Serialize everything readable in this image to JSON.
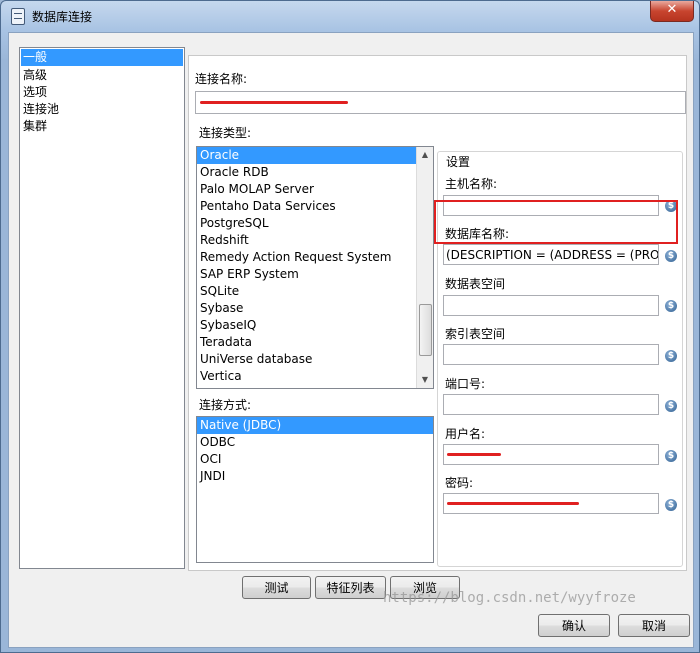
{
  "window": {
    "title": "数据库连接",
    "close_glyph": "✕"
  },
  "nav": {
    "items": [
      "一般",
      "高级",
      "选项",
      "连接池",
      "集群"
    ],
    "selected_index": 0
  },
  "general": {
    "conn_name_label": "连接名称:",
    "conn_type_label": "连接类型:",
    "conn_types": [
      "Oracle",
      "Oracle RDB",
      "Palo MOLAP Server",
      "Pentaho Data Services",
      "PostgreSQL",
      "Redshift",
      "Remedy Action Request System",
      "SAP ERP System",
      "SQLite",
      "Sybase",
      "SybaseIQ",
      "Teradata",
      "UniVerse database",
      "Vertica"
    ],
    "conn_types_selected": "Oracle",
    "access_label": "连接方式:",
    "access_methods": [
      "Native (JDBC)",
      "ODBC",
      "OCI",
      "JNDI"
    ],
    "access_selected": "Native (JDBC)"
  },
  "settings": {
    "group_label": "设置",
    "host_label": "主机名称:",
    "host_value": "",
    "db_name_label": "数据库名称:",
    "db_name_value": "(DESCRIPTION = (ADDRESS = (PROTOCOL",
    "tablespace_data_label": "数据表空间",
    "tablespace_data_value": "",
    "tablespace_index_label": "索引表空间",
    "tablespace_index_value": "",
    "port_label": "端口号:",
    "port_value": "",
    "user_label": "用户名:",
    "password_label": "密码:",
    "variable_icon": "$"
  },
  "buttons": {
    "test": "测试",
    "features": "特征列表",
    "browse": "浏览",
    "ok": "确认",
    "cancel": "取消"
  },
  "watermark": "https://blog.csdn.net/wyyfroze",
  "icons": {
    "window": "database-icon",
    "variable": "dollar-sign-icon"
  },
  "colors": {
    "selection": "#3399ff",
    "highlight_box": "#e02020",
    "redaction": "#e02020"
  }
}
